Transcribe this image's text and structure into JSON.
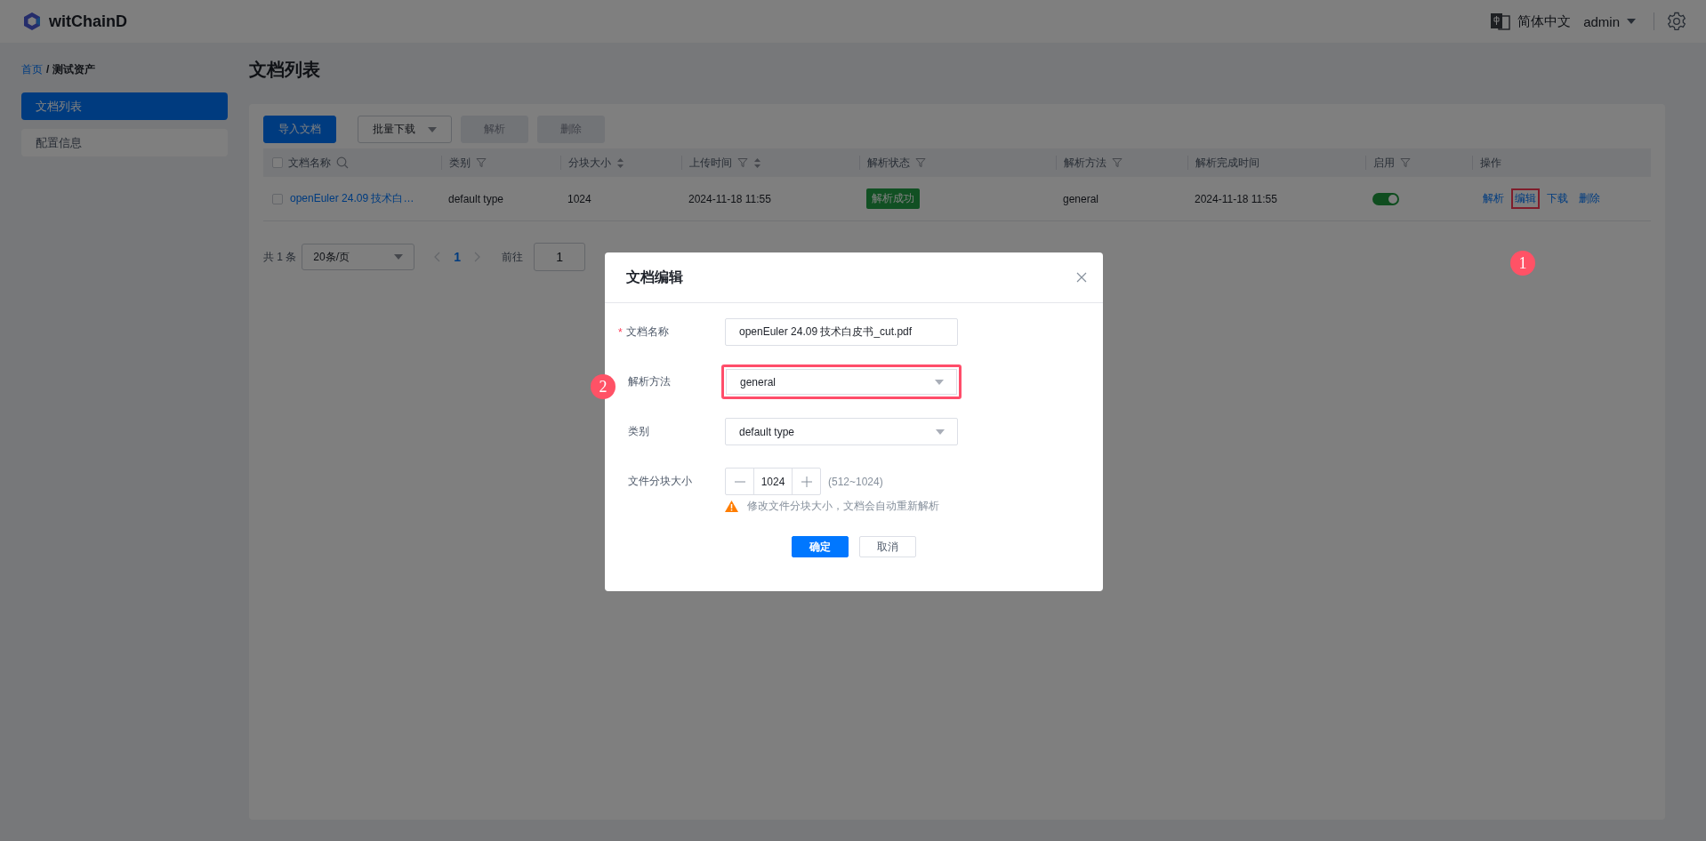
{
  "header": {
    "app_name": "witChainD",
    "language": "简体中文",
    "user": "admin"
  },
  "breadcrumb": {
    "items": [
      {
        "label": "首页",
        "kind": "link"
      },
      {
        "label": "测试资产",
        "kind": "current"
      }
    ],
    "separator": "/"
  },
  "sidebar": {
    "items": [
      {
        "label": "文档列表",
        "selected": true
      },
      {
        "label": "配置信息",
        "selected": false
      }
    ]
  },
  "page_title": "文档列表",
  "toolbar": {
    "buttons": [
      {
        "label": "导入文档",
        "kind": "primary",
        "disabled": false
      },
      {
        "label": "批量下载",
        "kind": "dropdown",
        "disabled": false
      },
      {
        "label": "解析",
        "kind": "plain",
        "disabled": true
      },
      {
        "label": "删除",
        "kind": "plain",
        "disabled": true
      }
    ]
  },
  "table": {
    "header_checked": false,
    "columns": [
      {
        "label": "文档名称",
        "kind": "search"
      },
      {
        "label": "类别",
        "kind": "filter"
      },
      {
        "label": "分块大小",
        "kind": "sort"
      },
      {
        "label": "上传时间",
        "kind": "filter_sort"
      },
      {
        "label": "解析状态",
        "kind": "filter"
      },
      {
        "label": "解析方法",
        "kind": "filter"
      },
      {
        "label": "解析完成时间",
        "kind": "plain"
      },
      {
        "label": "启用",
        "kind": "filter"
      },
      {
        "label": "操作",
        "kind": "plain"
      }
    ],
    "rows": [
      {
        "checked": false,
        "name": "openEuler 24.09 技术白…",
        "category": "default type",
        "chunk_size": "1024",
        "uploaded": "2024-11-18 11:55",
        "status": "解析成功",
        "method": "general",
        "finished": "2024-11-18 11:55",
        "enabled": true,
        "actions": [
          {
            "label": "解析",
            "highlighted": false
          },
          {
            "label": "编辑",
            "highlighted": true
          },
          {
            "label": "下载",
            "highlighted": false
          },
          {
            "label": "删除",
            "highlighted": false
          }
        ]
      }
    ]
  },
  "pagination": {
    "total": "共 1 条",
    "page_size": "20条/页",
    "pages": [
      {
        "label": "1",
        "selected": true
      }
    ],
    "goto_label": "前往",
    "goto_value": "1"
  },
  "dialog": {
    "title": "文档编辑",
    "fields": [
      {
        "kind": "text",
        "label": "文档名称",
        "required_mark": "*",
        "value": "openEuler 24.09 技术白皮书_cut.pdf",
        "highlighted": false
      },
      {
        "kind": "select",
        "label": "解析方法",
        "value": "general",
        "highlighted": true
      },
      {
        "kind": "select",
        "label": "类别",
        "value": "default type",
        "highlighted": false
      },
      {
        "kind": "stepper",
        "label": "文件分块大小",
        "value": "1024",
        "range": "(512~1024)",
        "warning": "修改文件分块大小，文档会自动重新解析",
        "highlighted": false
      }
    ],
    "buttons": [
      {
        "label": "确定",
        "kind": "primary"
      },
      {
        "label": "取消",
        "kind": "default"
      }
    ]
  },
  "annotations": [
    {
      "label": "1"
    },
    {
      "label": "2"
    }
  ]
}
